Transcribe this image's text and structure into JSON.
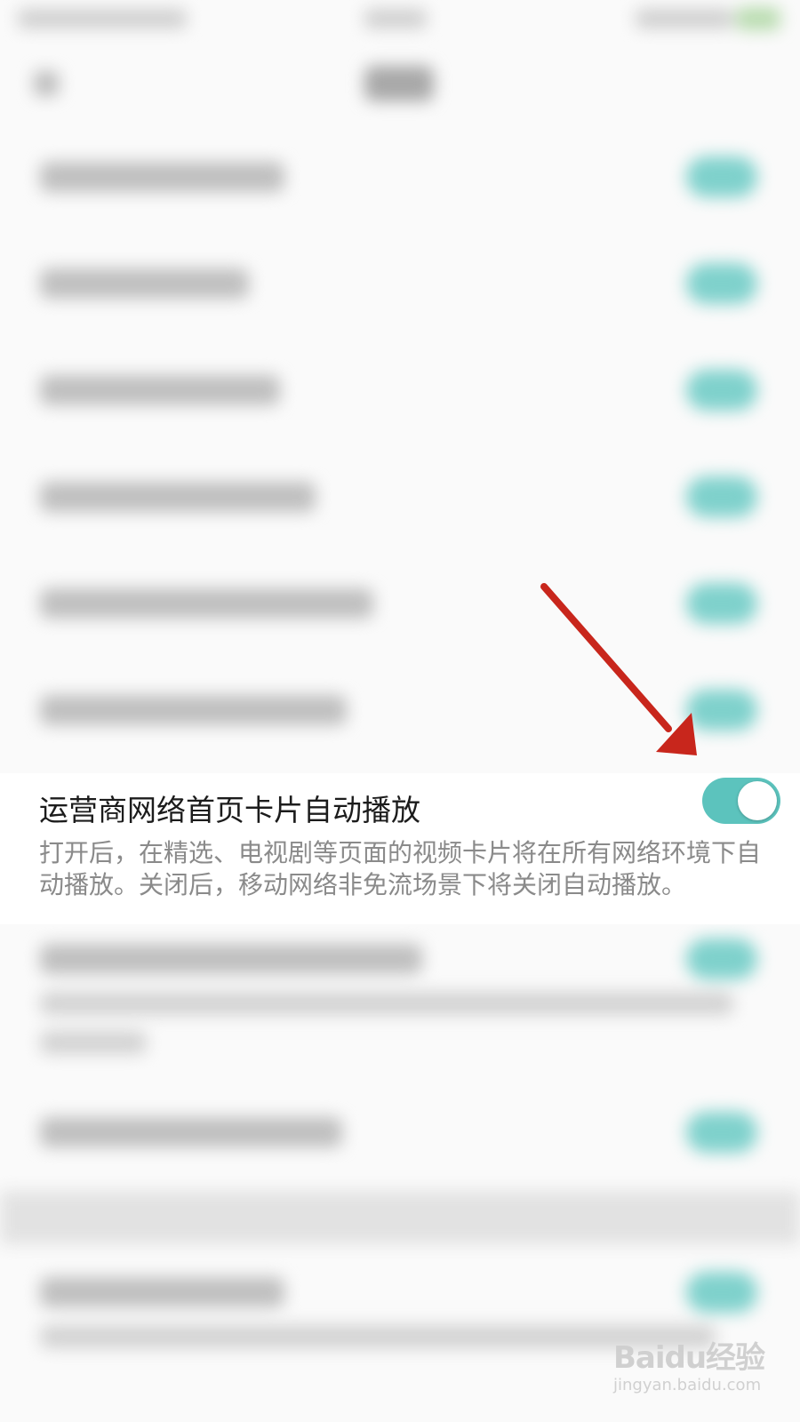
{
  "setting": {
    "title": "运营商网络首页卡片自动播放",
    "description": "打开后，在精选、电视剧等页面的视频卡片将在所有网络环境下自动播放。关闭后，移动网络非免流场景下将关闭自动播放。",
    "toggle_state": "on"
  },
  "annotation": {
    "icon": "red-arrow-icon",
    "color": "#c8261c"
  },
  "watermark": {
    "logo_text": "Baidu经验",
    "url": "jingyan.baidu.com"
  },
  "colors": {
    "toggle_on": "#5cc3bd",
    "title_text": "#1c1c1c",
    "description_text": "#8a8a8a"
  }
}
